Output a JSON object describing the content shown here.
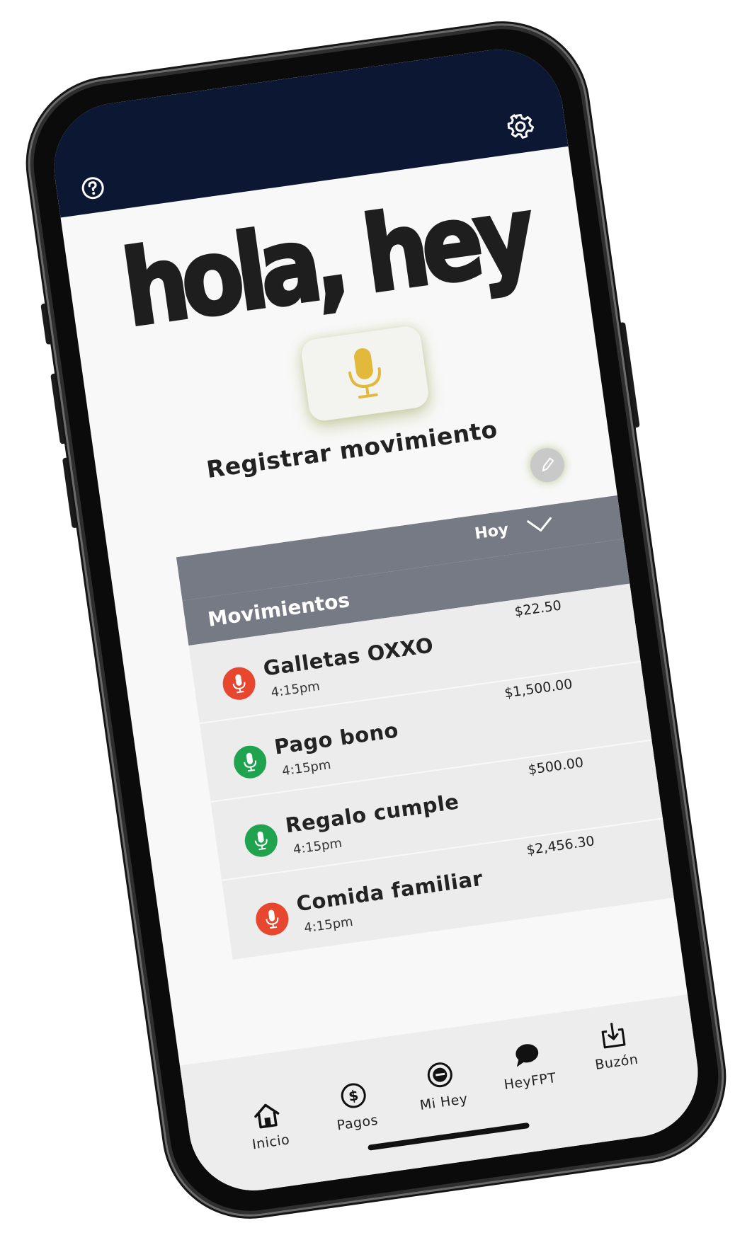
{
  "app": {
    "brand_text": "hola, hey"
  },
  "header": {
    "help_icon": "question-circle-icon",
    "settings_icon": "gear-icon"
  },
  "register": {
    "icon": "microphone-icon",
    "icon_color": "#e2b93b",
    "label": "Registrar movimiento",
    "edit_icon": "pencil-icon"
  },
  "filter": {
    "selected": "Hoy",
    "chevron_icon": "chevron-down-icon"
  },
  "movements": {
    "title": "Movimientos",
    "items": [
      {
        "title": "Galletas OXXO",
        "time": "4:15pm",
        "amount": "$22.50",
        "type": "expense",
        "color": "#e8472f"
      },
      {
        "title": "Pago bono",
        "time": "4:15pm",
        "amount": "$1,500.00",
        "type": "income",
        "color": "#1fa34f"
      },
      {
        "title": "Regalo cumple",
        "time": "4:15pm",
        "amount": "$500.00",
        "type": "income",
        "color": "#1fa34f"
      },
      {
        "title": "Comida familiar",
        "time": "4:15pm",
        "amount": "$2,456.30",
        "type": "expense",
        "color": "#e8472f"
      }
    ]
  },
  "nav": {
    "items": [
      {
        "label": "Inicio",
        "icon": "home-icon"
      },
      {
        "label": "Pagos",
        "icon": "dollar-circle-icon"
      },
      {
        "label": "Mi Hey",
        "icon": "hey-logo-icon"
      },
      {
        "label": "HeyFPT",
        "icon": "chat-bubble-icon"
      },
      {
        "label": "Buzón",
        "icon": "inbox-download-icon"
      }
    ]
  },
  "colors": {
    "topbar": "#0b1733",
    "section_header": "#757a84",
    "list_bg": "#ececec",
    "expense": "#e8472f",
    "income": "#1fa34f"
  }
}
